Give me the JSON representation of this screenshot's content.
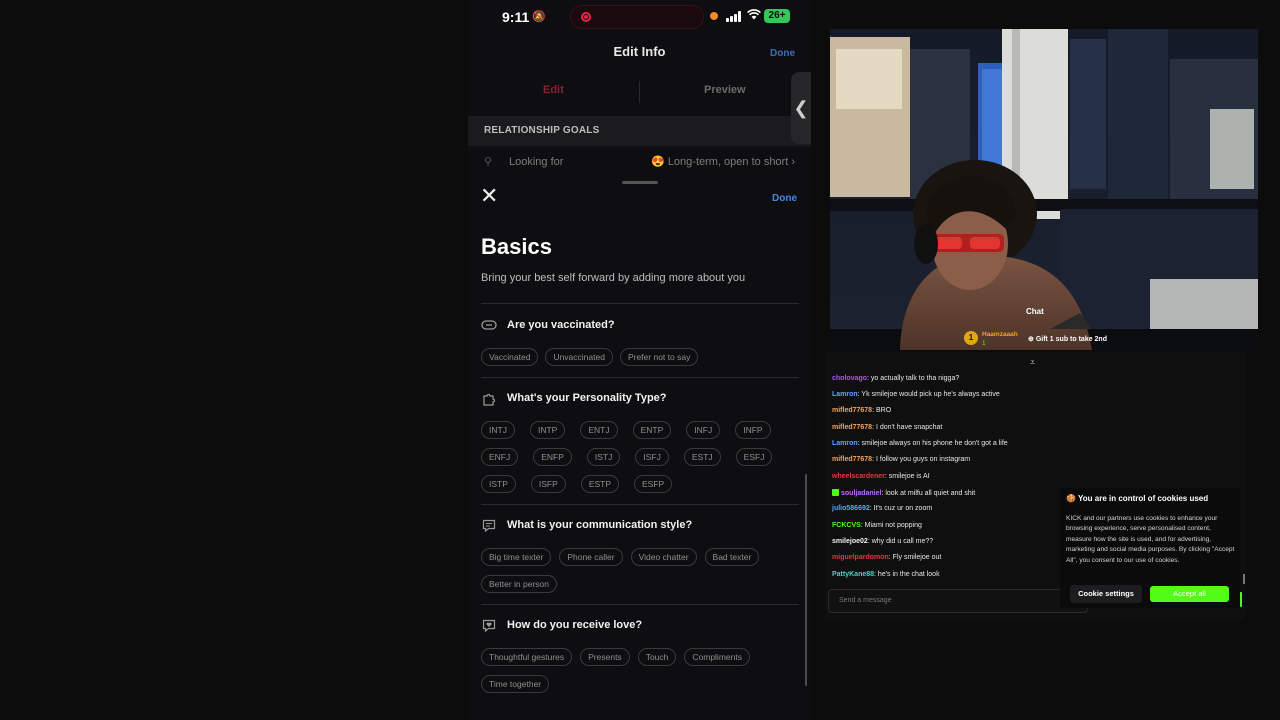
{
  "phone": {
    "status": {
      "time": "9:11",
      "battery": "26+"
    },
    "edit_info": {
      "title": "Edit Info",
      "done": "Done",
      "tabs": [
        "Edit",
        "Preview"
      ],
      "section_header": "RELATIONSHIP GOALS",
      "looking_for_label": "Looking for",
      "looking_for_value": "😍 Long-term, open to short ›"
    },
    "sheet": {
      "done": "Done",
      "title": "Basics",
      "subtitle": "Bring your best self forward by adding more about you",
      "questions": [
        {
          "icon": "vaccine-icon",
          "title": "Are you vaccinated?",
          "options": [
            "Vaccinated",
            "Unvaccinated",
            "Prefer not to say"
          ]
        },
        {
          "icon": "puzzle-icon",
          "title": "What's your Personality Type?",
          "options": [
            "INTJ",
            "INTP",
            "ENTJ",
            "ENTP",
            "INFJ",
            "INFP",
            "ENFJ",
            "ENFP",
            "ISTJ",
            "ISFJ",
            "ESTJ",
            "ESFJ",
            "ISTP",
            "ISFP",
            "ESTP",
            "ESFP"
          ]
        },
        {
          "icon": "chat-bubble-icon",
          "title": "What is your communication style?",
          "options": [
            "Big time texter",
            "Phone caller",
            "Video chatter",
            "Bad texter",
            "Better in person"
          ]
        },
        {
          "icon": "heart-bubble-icon",
          "title": "How do you receive love?",
          "options": [
            "Thoughtful gestures",
            "Presents",
            "Touch",
            "Compliments",
            "Time together"
          ]
        }
      ]
    }
  },
  "stream": {
    "overlay": {
      "chat_label": "Chat",
      "gifter_name": "Haamzaaah",
      "gifter_count": "1",
      "gift_text": "Gift 1 sub to take 2nd"
    },
    "chat": [
      {
        "user": "cholovago",
        "color": "#a855f7",
        "text": ": yo actually talk to tha nigga?"
      },
      {
        "user": "Lamron",
        "color": "#5aa7ff",
        "text": ": Yk smilejoe would pick up he's always active"
      },
      {
        "user": "mifled77678",
        "color": "#f5a25a",
        "text": ": BRO"
      },
      {
        "user": "mifled77678",
        "color": "#f5a25a",
        "text": ": I don't have snapchat"
      },
      {
        "user": "Lamron",
        "color": "#5aa7ff",
        "text": ": smilejoe always on his phone he don't got a life"
      },
      {
        "user": "mifled77678",
        "color": "#f5a25a",
        "text": ": I follow you guys on instagram"
      },
      {
        "user": "wheelscardener",
        "color": "#e23b3b",
        "text": ": smilejoe is AI"
      },
      {
        "user": "souljadaniel",
        "color": "#c36bff",
        "text": ": look at milfu all quiet and shit",
        "badge": true
      },
      {
        "user": "julio586692",
        "color": "#5aa7ff",
        "text": ": It's cuz ur on zoom"
      },
      {
        "user": "FCKCVS",
        "color": "#53fc18",
        "text": ": Miami not popping"
      },
      {
        "user": "smilejoe02",
        "color": "#f2f2f2",
        "text": ": why did u call me??"
      },
      {
        "user": "miguelpardomon",
        "color": "#e23b3b",
        "text": ": Fly smilejoe out"
      },
      {
        "user": "PattyKane88",
        "color": "#4dd2c9",
        "text": ": he's in the chat look"
      }
    ],
    "send_placeholder": "Send a message",
    "cookie": {
      "title": "You are in control of cookies used",
      "body": "KICK and our partners use cookies to enhance your browsing experience, serve personalised content, measure how the site is used, and for advertising, marketing and social media purposes. By clicking \"Accept All\", you consent to our use of cookies.",
      "settings": "Cookie settings",
      "accept": "Accept all"
    }
  }
}
